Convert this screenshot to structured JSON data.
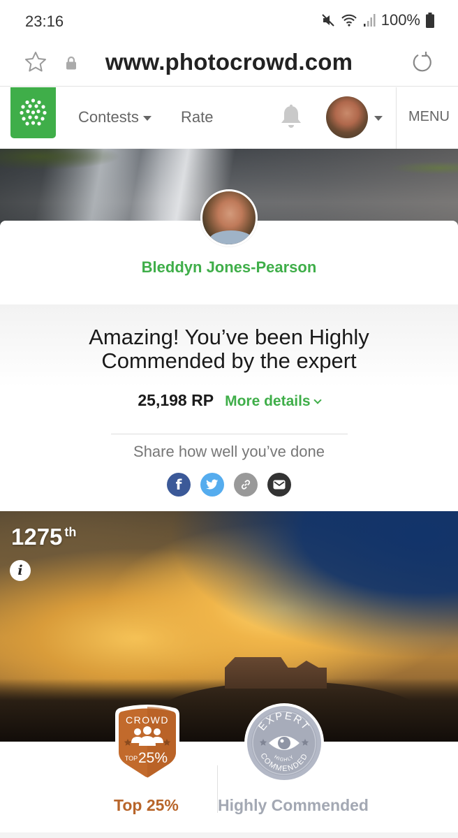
{
  "status_bar": {
    "time": "23:16",
    "icons": [
      "mute-icon",
      "wifi-icon",
      "signal-icon"
    ],
    "battery": "100%"
  },
  "browser": {
    "url": "www.photocrowd.com",
    "icons": [
      "bookmark-star-icon",
      "lock-icon",
      "reload-icon"
    ]
  },
  "nav": {
    "logo": "photocrowd-logo",
    "contests_label": "Contests",
    "rate_label": "Rate",
    "menu_label": "MENU",
    "icons": [
      "bell-icon",
      "user-avatar",
      "chevron-down-icon"
    ]
  },
  "profile": {
    "name": "Bleddyn Jones-Pearson"
  },
  "result": {
    "heading_line1": "Amazing! You’ve been Highly",
    "heading_line2": "Commended by the expert",
    "rp_value": "25,198 RP",
    "more_details_label": "More details",
    "share_label": "Share how well you’ve done",
    "share_buttons": [
      {
        "name": "facebook",
        "glyph": "f"
      },
      {
        "name": "twitter",
        "glyph": "twitter-bird"
      },
      {
        "name": "copy-link",
        "glyph": "link"
      },
      {
        "name": "email",
        "glyph": "envelope"
      }
    ]
  },
  "photo": {
    "rank_number": "1275",
    "rank_suffix": "th",
    "info_glyph": "i"
  },
  "awards": {
    "crowd": {
      "badge_title": "CROWD",
      "badge_top": "TOP",
      "badge_value": "25%",
      "label": "Top 25%",
      "color": "#b8652a"
    },
    "expert": {
      "badge_title": "EXPERT",
      "badge_sub1": "HIGHLY",
      "badge_sub2": "COMMENDED",
      "label": "Highly Commended",
      "color": "#a3a8b3"
    }
  },
  "colors": {
    "brand_green": "#3fae49",
    "facebook": "#3b5998",
    "twitter": "#55acee",
    "link": "#999999",
    "email": "#333333"
  }
}
